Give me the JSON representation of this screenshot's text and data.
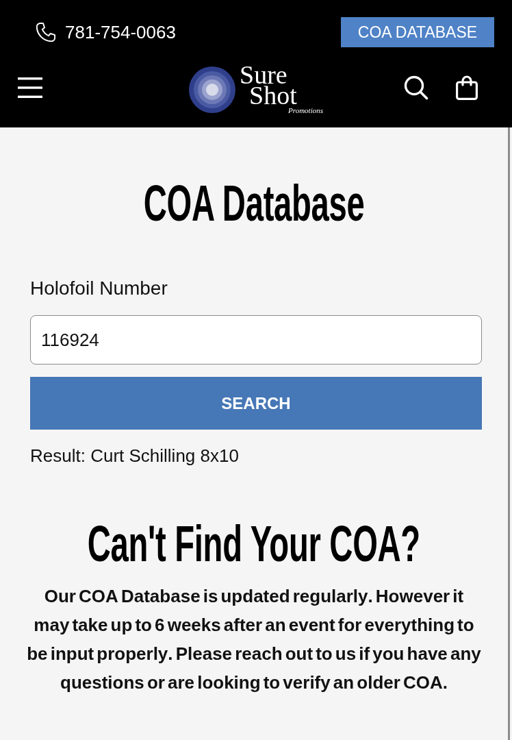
{
  "top_bar": {
    "phone": "781-754-0063",
    "button": "COA DATABASE"
  },
  "nav": {
    "logo": {
      "line_1": "Sure",
      "line_2": "Shot",
      "tagline": "Promotions"
    }
  },
  "lookup": {
    "title": "COA Database",
    "label": "Holofoil Number",
    "value": "116924",
    "button": "SEARCH",
    "result": "Result: Curt Schilling 8x10"
  },
  "help": {
    "title": "Can't Find Your COA?",
    "text": "Our COA Database is updated regularly. However it may take up to 6 weeks after an event for everything to be input properly. Please reach out to us if you have any questions or are looking to verify an older COA."
  }
}
